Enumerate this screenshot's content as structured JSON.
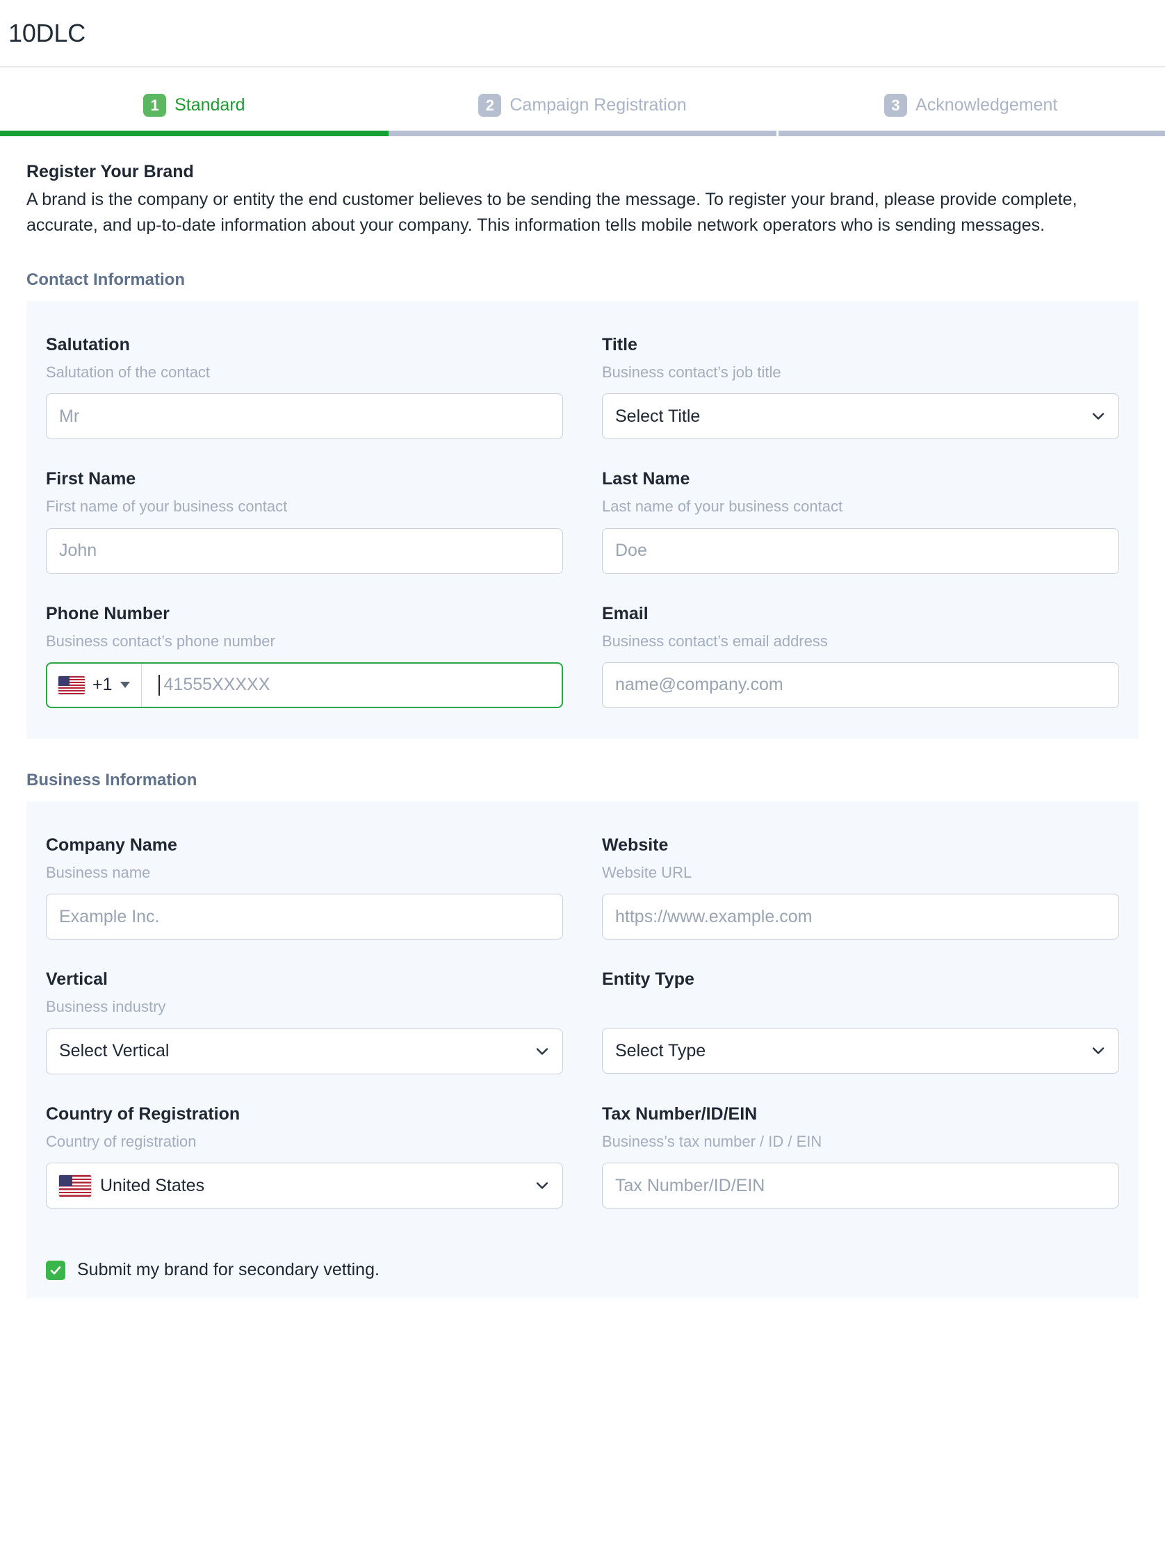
{
  "window": {
    "title": "10DLC"
  },
  "stepper": {
    "steps": [
      {
        "number": "1",
        "label": "Standard",
        "state": "active"
      },
      {
        "number": "2",
        "label": "Campaign Registration",
        "state": "inactive"
      },
      {
        "number": "3",
        "label": "Acknowledgement",
        "state": "inactive"
      }
    ]
  },
  "intro": {
    "title": "Register Your Brand",
    "body": "A brand is the company or entity the end customer believes to be sending the message. To register your brand, please provide complete, accurate, and up-to-date information about your company. This information tells mobile network operators who is sending messages."
  },
  "contact_section": {
    "title": "Contact Information",
    "salutation": {
      "label": "Salutation",
      "hint": "Salutation of the contact",
      "placeholder": "Mr",
      "value": ""
    },
    "title_field": {
      "label": "Title",
      "hint": "Business contact’s job title",
      "selected": "Select Title"
    },
    "first_name": {
      "label": "First Name",
      "hint": "First name of your business contact",
      "placeholder": "John",
      "value": ""
    },
    "last_name": {
      "label": "Last Name",
      "hint": "Last name of your business contact",
      "placeholder": "Doe",
      "value": ""
    },
    "phone": {
      "label": "Phone Number",
      "hint": "Business contact’s phone number",
      "country_flag": "us-flag-icon",
      "dial_code": "+1",
      "placeholder": "41555XXXXX",
      "value": ""
    },
    "email": {
      "label": "Email",
      "hint": "Business contact’s email address",
      "placeholder": "name@company.com",
      "value": ""
    }
  },
  "business_section": {
    "title": "Business Information",
    "company_name": {
      "label": "Company Name",
      "hint": "Business name",
      "placeholder": "Example Inc.",
      "value": ""
    },
    "website": {
      "label": "Website",
      "hint": "Website URL",
      "placeholder": "https://www.example.com",
      "value": ""
    },
    "vertical": {
      "label": "Vertical",
      "hint": "Business industry",
      "selected": "Select Vertical"
    },
    "entity_type": {
      "label": "Entity Type",
      "hint": "",
      "selected": "Select Type"
    },
    "country": {
      "label": "Country of Registration",
      "hint": "Country of registration",
      "selected": "United States",
      "flag": "us-flag-icon"
    },
    "tax_number": {
      "label": "Tax Number/ID/EIN",
      "hint": "Business’s tax number / ID / EIN",
      "placeholder": "Tax Number/ID/EIN",
      "value": ""
    }
  },
  "vetting": {
    "label": "Submit my brand for secondary vetting.",
    "checked": true
  },
  "colors": {
    "active_green": "#16a034",
    "badge_green": "#5cb860",
    "inactive_gray": "#b6bfcf",
    "panel_bg": "#f5f8fd",
    "section_heading": "#60718c",
    "focus_green": "#27a844",
    "checkbox_green": "#3ab54a"
  }
}
